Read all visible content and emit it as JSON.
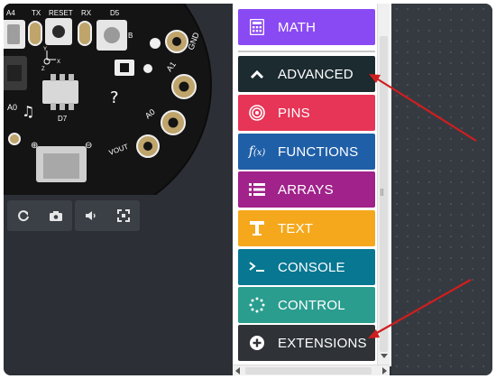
{
  "toolbox": {
    "categories": [
      {
        "id": "math",
        "label": "MATH",
        "icon": "calculator-icon",
        "color": "#8a4af3"
      },
      {
        "id": "advanced",
        "label": "ADVANCED",
        "icon": "chevron-up-icon",
        "color": "#1c2b2f"
      },
      {
        "id": "pins",
        "label": "PINS",
        "icon": "target-icon",
        "color": "#e63557"
      },
      {
        "id": "functions",
        "label": "FUNCTIONS",
        "icon": "function-icon",
        "color": "#1f5fa8"
      },
      {
        "id": "arrays",
        "label": "ARRAYS",
        "icon": "list-icon",
        "color": "#a0228a"
      },
      {
        "id": "text",
        "label": "TEXT",
        "icon": "text-t-icon",
        "color": "#f5a81c"
      },
      {
        "id": "console",
        "label": "CONSOLE",
        "icon": "terminal-icon",
        "color": "#077792"
      },
      {
        "id": "control",
        "label": "CONTROL",
        "icon": "dotted-circle-icon",
        "color": "#2a9d8f"
      },
      {
        "id": "extensions",
        "label": "EXTENSIONS",
        "icon": "plus-circle-icon",
        "color": "#2f3237"
      }
    ]
  },
  "board": {
    "labels": {
      "pin_a4": "A4",
      "tx": "TX",
      "reset": "RESET",
      "rx": "RX",
      "d5": "D5",
      "gnd": "GND",
      "a0": "A0",
      "d7": "D7",
      "a1": "A1",
      "a0_pad": "A0",
      "vout": "VOUT",
      "plus": "⊕",
      "minus": "⊖",
      "axis_x": "X",
      "axis_y": "Y",
      "axis_z": "Z"
    }
  },
  "simulator_controls": {
    "group1": [
      "refresh-icon",
      "camera-icon"
    ],
    "group2": [
      "volume-icon",
      "fullscreen-icon"
    ]
  },
  "colors": {
    "annotation_arrow": "#d01e1e",
    "workspace_bg": "#353a41",
    "sim_bg": "#2c3036"
  }
}
